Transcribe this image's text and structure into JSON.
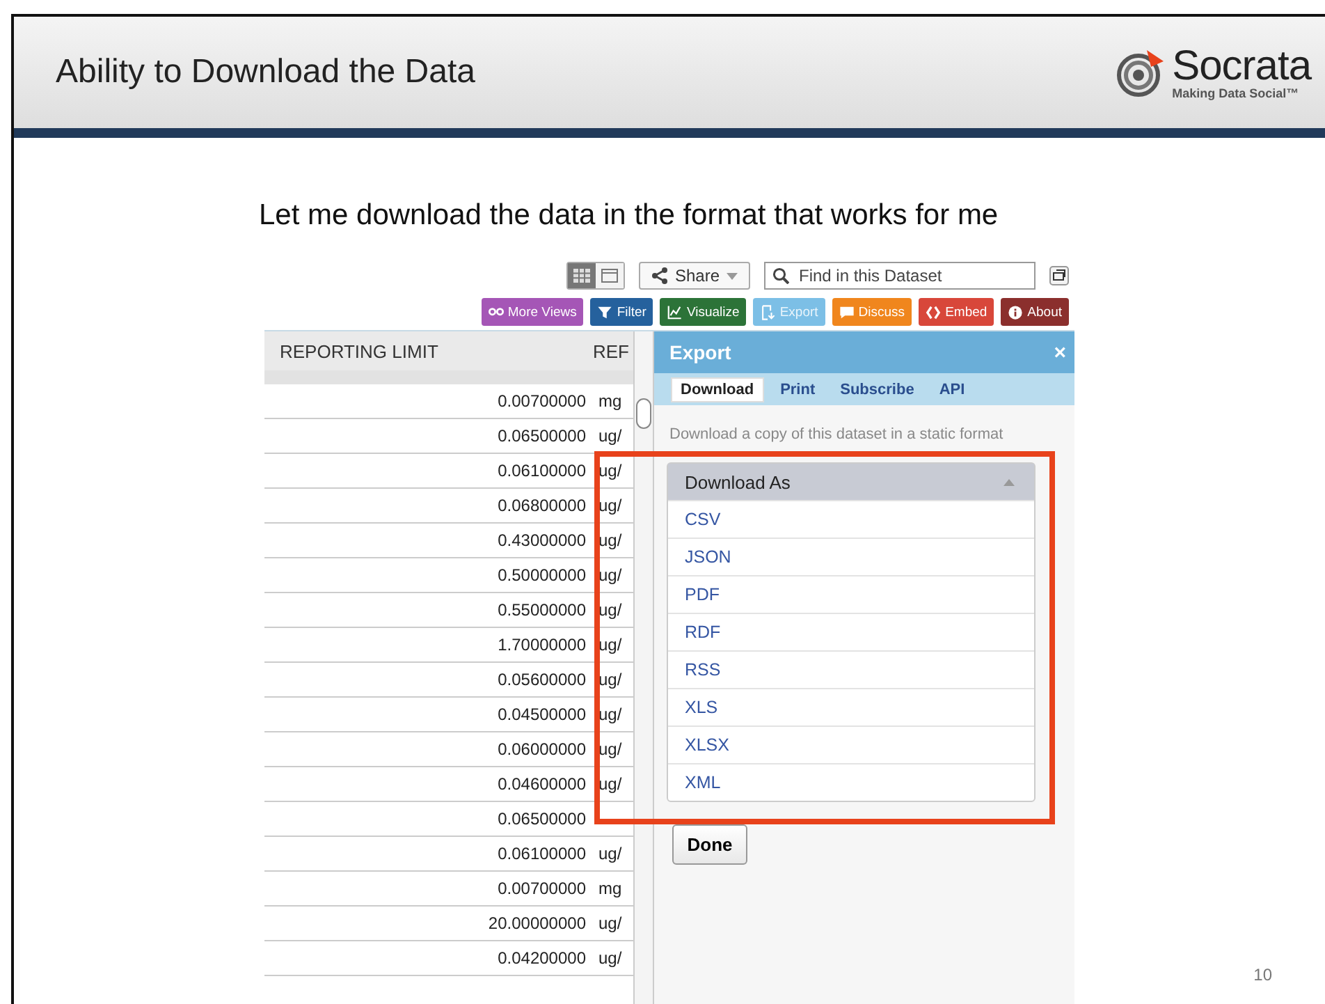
{
  "slide": {
    "title": "Ability to Download the Data",
    "logo": {
      "name": "Socrata",
      "tagline": "Making Data Social™"
    },
    "subtitle": "Let me download the data in the format that works for me",
    "page_number": "10"
  },
  "toolbar": {
    "view_toggles": [
      {
        "kind": "grid",
        "selected": true
      },
      {
        "kind": "page",
        "selected": false
      }
    ],
    "share": "Share",
    "search": {
      "placeholder": "Find in this Dataset"
    },
    "actions": [
      {
        "label": "More Views",
        "kind": "binoculars",
        "color": "#a556b6",
        "selected": false
      },
      {
        "label": "Filter",
        "kind": "filter",
        "color": "#25619d",
        "selected": false
      },
      {
        "label": "Visualize",
        "kind": "chart",
        "color": "#2c7338",
        "selected": false
      },
      {
        "label": "Export",
        "kind": "export",
        "color": "#7cbfe6",
        "selected": true
      },
      {
        "label": "Discuss",
        "kind": "comment",
        "color": "#f0861d",
        "selected": false
      },
      {
        "label": "Embed",
        "kind": "code",
        "color": "#d8473a",
        "selected": false
      },
      {
        "label": "About",
        "kind": "info",
        "color": "#8b2f2d",
        "selected": false
      }
    ]
  },
  "table": {
    "columns": [
      "REPORTING LIMIT",
      "REF"
    ],
    "rows": [
      {
        "limit": "0.00700000",
        "unit": "mg"
      },
      {
        "limit": "0.06500000",
        "unit": "ug/"
      },
      {
        "limit": "0.06100000",
        "unit": "ug/"
      },
      {
        "limit": "0.06800000",
        "unit": "ug/"
      },
      {
        "limit": "0.43000000",
        "unit": "ug/"
      },
      {
        "limit": "0.50000000",
        "unit": "ug/"
      },
      {
        "limit": "0.55000000",
        "unit": "ug/"
      },
      {
        "limit": "1.70000000",
        "unit": "ug/"
      },
      {
        "limit": "0.05600000",
        "unit": "ug/"
      },
      {
        "limit": "0.04500000",
        "unit": "ug/"
      },
      {
        "limit": "0.06000000",
        "unit": "ug/"
      },
      {
        "limit": "0.04600000",
        "unit": "ug/"
      },
      {
        "limit": "0.06500000"
      },
      {
        "limit": "0.06100000",
        "unit": "ug/"
      },
      {
        "limit": "0.00700000",
        "unit": "mg"
      },
      {
        "limit": "20.00000000",
        "unit": "ug/"
      },
      {
        "limit": "0.04200000",
        "unit": "ug/"
      }
    ]
  },
  "export_panel": {
    "title": "Export",
    "close": "×",
    "tabs": [
      {
        "label": "Download",
        "selected": true
      },
      {
        "label": "Print",
        "selected": false
      },
      {
        "label": "Subscribe",
        "selected": false
      },
      {
        "label": "API",
        "selected": false
      }
    ],
    "description": "Download a copy of this dataset in a static format",
    "dropdown": {
      "label": "Download As",
      "expanded": true,
      "options": [
        "CSV",
        "JSON",
        "PDF",
        "RDF",
        "RSS",
        "XLS",
        "XLSX",
        "XML"
      ]
    },
    "done": "Done"
  }
}
